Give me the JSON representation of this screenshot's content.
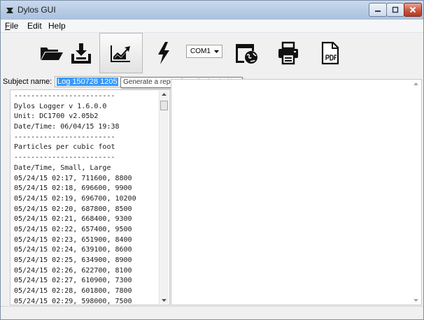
{
  "window": {
    "title": "Dylos GUI"
  },
  "menu": {
    "items": [
      {
        "label_mnemonic": "F",
        "label_rest": "ile"
      },
      {
        "label_mnemonic": "",
        "label_rest": "Edit"
      },
      {
        "label_mnemonic": "",
        "label_rest": "Help"
      }
    ]
  },
  "toolbar": {
    "icons": [
      "folder-open-icon",
      "download-icon",
      "chart-report-icon",
      "lightning-icon",
      "globe-window-icon",
      "printer-icon",
      "pdf-icon"
    ],
    "port": {
      "selected": "COM1"
    },
    "active_button": "chart-report-icon"
  },
  "subject": {
    "label": "Subject name:",
    "value": "Log 150728 1205"
  },
  "tooltip": {
    "text": "Generate a report from the loaded log"
  },
  "log": {
    "lines": [
      "------------------------",
      "Dylos Logger v 1.6.0.0",
      "Unit: DC1700 v2.05b2",
      "Date/Time: 06/04/15 19:38",
      "------------------------",
      "Particles per cubic foot",
      "------------------------",
      "Date/Time, Small, Large",
      "05/24/15 02:17, 711600, 8800",
      "05/24/15 02:18, 696600, 9900",
      "05/24/15 02:19, 696700, 10200",
      "05/24/15 02:20, 687800, 8500",
      "05/24/15 02:21, 668400, 9300",
      "05/24/15 02:22, 657400, 9500",
      "05/24/15 02:23, 651900, 8400",
      "05/24/15 02:24, 639100, 8600",
      "05/24/15 02:25, 634900, 8900",
      "05/24/15 02:26, 622700, 8100",
      "05/24/15 02:27, 610900, 7300",
      "05/24/15 02:28, 601800, 7800",
      "05/24/15 02:29, 598000, 7500"
    ]
  },
  "colors": {
    "titlebar": "#b7cbe4",
    "selection": "#3399ff",
    "close_button": "#c8513b"
  }
}
